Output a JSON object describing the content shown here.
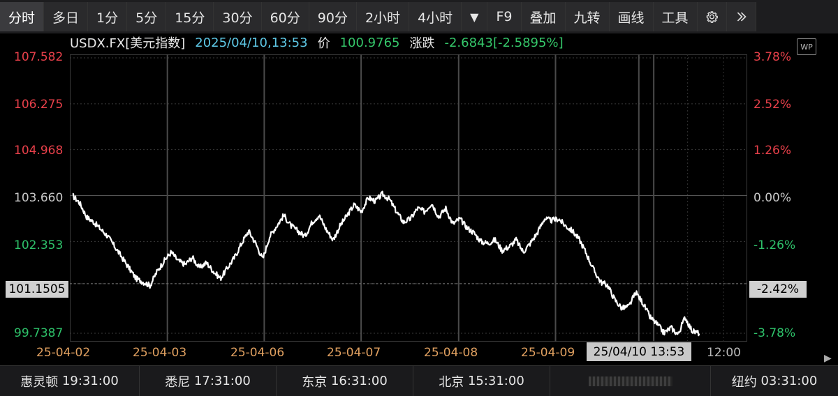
{
  "toolbar": {
    "items": [
      {
        "label": "分时",
        "active": true
      },
      {
        "label": "多日"
      },
      {
        "label": "1分"
      },
      {
        "label": "5分"
      },
      {
        "label": "15分"
      },
      {
        "label": "30分"
      },
      {
        "label": "60分"
      },
      {
        "label": "90分"
      },
      {
        "label": "2小时"
      },
      {
        "label": "4小时"
      },
      {
        "label": "▼"
      },
      {
        "label": "F9"
      },
      {
        "label": "叠加"
      },
      {
        "label": "九转"
      },
      {
        "label": "画线"
      },
      {
        "label": "工具"
      }
    ],
    "settings_icon": "gear-icon",
    "more_icon": "double-chevron-right-icon"
  },
  "info": {
    "symbol": "USDX.FX[美元指数]",
    "datetime": "2025/04/10,13:53",
    "price_label": "价",
    "price": "100.9765",
    "change_label": "涨跌",
    "change": "-2.6843[-2.5895%]"
  },
  "wp_icon_text": "WP",
  "chart_data": {
    "type": "line",
    "title": "",
    "series": [
      {
        "name": "USDX.FX[美元指数]",
        "values": [
          103.66,
          103.45,
          103.05,
          102.9,
          102.7,
          102.5,
          102.2,
          101.9,
          101.6,
          101.3,
          101.2,
          101.1,
          101.5,
          101.8,
          102.05,
          101.8,
          101.7,
          101.9,
          101.6,
          101.75,
          101.5,
          101.3,
          101.6,
          101.9,
          102.3,
          102.65,
          102.3,
          101.85,
          102.5,
          102.8,
          103.1,
          102.8,
          102.65,
          102.5,
          102.9,
          103.1,
          102.7,
          102.4,
          102.8,
          103.1,
          103.4,
          103.2,
          103.6,
          103.5,
          103.7,
          103.55,
          103.2,
          102.9,
          103.0,
          103.3,
          103.2,
          103.45,
          103.05,
          103.3,
          102.85,
          103.0,
          102.75,
          102.6,
          102.35,
          102.3,
          102.4,
          102.1,
          102.2,
          102.4,
          102.05,
          102.3,
          102.6,
          103.0,
          102.95,
          103.0,
          102.8,
          102.65,
          102.4,
          102.0,
          101.55,
          101.2,
          101.1,
          100.7,
          100.45,
          100.5,
          100.9,
          100.6,
          100.2,
          100.0,
          99.75,
          99.9,
          99.7,
          100.2,
          99.8,
          99.74
        ]
      }
    ],
    "x_tick_labels": [
      "25-04-02",
      "25-04-03",
      "25-04-06",
      "25-04-07",
      "25-04-08",
      "25-04-09",
      "12:00"
    ],
    "cursor_label": "25/04/10 13:53",
    "y_tick_labels": [
      "107.582",
      "106.275",
      "104.968",
      "103.660",
      "102.353",
      "101.1505",
      "99.7387"
    ],
    "y_pct_labels": [
      "3.78%",
      "2.52%",
      "1.26%",
      "0.00%",
      "-1.26%",
      "-2.42%",
      "-3.78%"
    ],
    "ylim": [
      99.7387,
      107.582
    ],
    "reference_price": 103.66,
    "current_price": 101.1505,
    "colors": {
      "line": "#ffffff",
      "up": "#e8404a",
      "down": "#2ec26a",
      "flat": "#c8c8c8",
      "date_labels": "#e0a060",
      "grid": "#3a3a3a"
    }
  },
  "clocks": [
    {
      "city": "惠灵顿",
      "time": "19:31:00"
    },
    {
      "city": "悉尼",
      "time": "17:31:00"
    },
    {
      "city": "东京",
      "time": "16:31:00"
    },
    {
      "city": "北京",
      "time": "15:31:00"
    },
    {
      "city": "纽约",
      "time": "03:31:00"
    }
  ]
}
